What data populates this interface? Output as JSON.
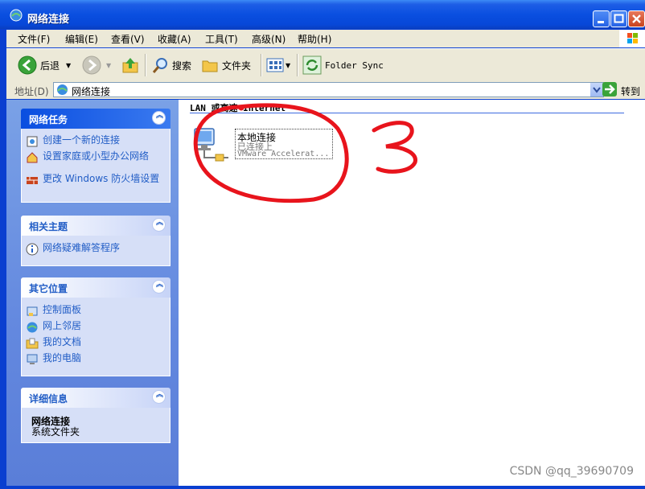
{
  "window": {
    "title": "网络连接"
  },
  "menu": [
    "文件(F)",
    "编辑(E)",
    "查看(V)",
    "收藏(A)",
    "工具(T)",
    "高级(N)",
    "帮助(H)"
  ],
  "toolbar": {
    "back": "后退",
    "search": "搜索",
    "folders": "文件夹",
    "folder_sync": "Folder Sync"
  },
  "address": {
    "label": "地址(D)",
    "value": "网络连接",
    "go": "转到"
  },
  "panels": {
    "tasks": {
      "title": "网络任务",
      "links": [
        "创建一个新的连接",
        "设置家庭或小型办公网络",
        "更改 Windows 防火墙设置"
      ]
    },
    "related": {
      "title": "相关主题",
      "links": [
        "网络疑难解答程序"
      ]
    },
    "places": {
      "title": "其它位置",
      "links": [
        "控制面板",
        "网上邻居",
        "我的文档",
        "我的电脑"
      ]
    },
    "details": {
      "title": "详细信息",
      "name": "网络连接",
      "type": "系统文件夹"
    }
  },
  "content": {
    "group_header": "LAN 或高速 Internet",
    "item": {
      "name": "本地连接",
      "status": "已连接上",
      "device": "VMware Accelerat..."
    }
  },
  "annotation": {
    "number": "3",
    "color": "#e8141c"
  },
  "watermark": "CSDN @qq_39690709"
}
